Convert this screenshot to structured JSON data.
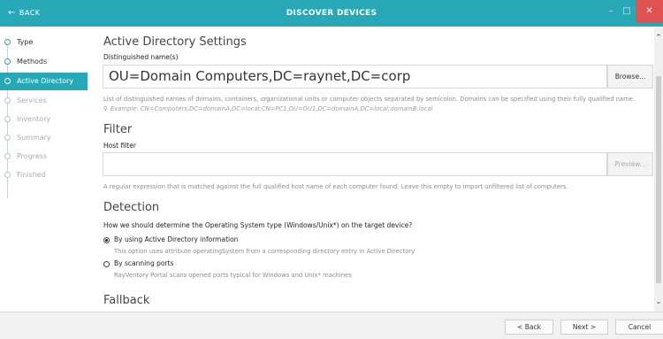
{
  "titlebar": {
    "back_label": "BACK",
    "back_arrow": "←",
    "title": "DISCOVER DEVICES",
    "minimize": "–",
    "maximize": "□",
    "close": "✕"
  },
  "sidebar": {
    "steps": [
      {
        "label": "Type",
        "state": "done"
      },
      {
        "label": "Methods",
        "state": "done"
      },
      {
        "label": "Active Directory",
        "state": "active"
      },
      {
        "label": "Services",
        "state": "pending"
      },
      {
        "label": "Inventory",
        "state": "pending"
      },
      {
        "label": "Summary",
        "state": "pending"
      },
      {
        "label": "Progress",
        "state": "pending"
      },
      {
        "label": "Finished",
        "state": "pending"
      }
    ]
  },
  "ad": {
    "title": "Active Directory Settings",
    "dn_label": "Distinguished name(s)",
    "dn_value": "OU=Domain Computers,DC=raynet,DC=corp",
    "browse_label": "Browse...",
    "help": "List of distinguished names of domains, containers, organizational units or computer objects separated by semicolon. Domains can be specified using their fully qualified name.",
    "example_icon": "pin-icon",
    "example": "Example: CN=Computers,DC=domainA,DC=local;CN=PC1,OU=OU1,DC=domainA,DC=local;domainB.local"
  },
  "filter": {
    "title": "Filter",
    "host_label": "Host filter",
    "host_value": "",
    "preview_label": "Preview...",
    "help": "A regular expression that is matched against the full qualified host name of each computer found. Leave this empty to import unfiltered list of computers."
  },
  "detection": {
    "title": "Detection",
    "question": "How we should determine the Operating System type (Windows/Unix*) on the target device?",
    "options": [
      {
        "label": "By using Active Directory information",
        "help": "This option uses attribute operatingSystem from a corresponding directory entry in Active Directory",
        "checked": true
      },
      {
        "label": "By scanning ports",
        "help": "RayVentory Portal scans opened ports typical for Windows and Unix* machines",
        "checked": false
      }
    ]
  },
  "fallback": {
    "title": "Fallback"
  },
  "scrollbar": {
    "up": "⌃",
    "down": "⌄"
  },
  "footer": {
    "back_label": "< Back",
    "next_label": "Next >",
    "cancel_label": "Cancel"
  },
  "colors": {
    "accent": "#27a8b6",
    "close": "#e05252"
  }
}
